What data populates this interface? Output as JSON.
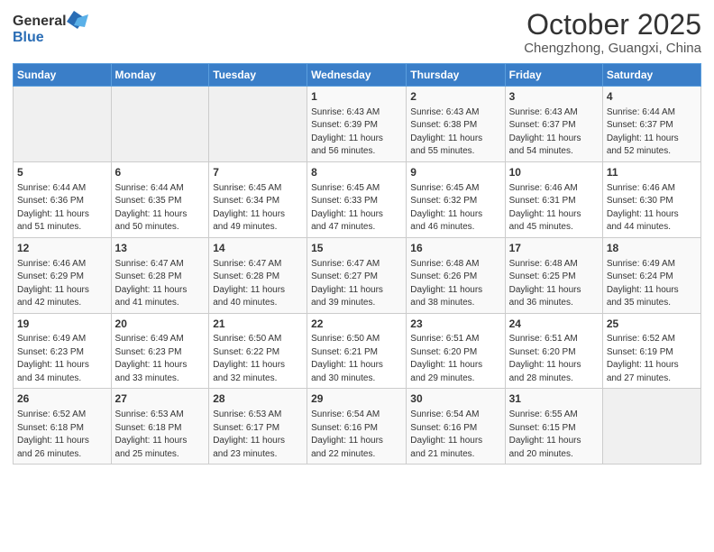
{
  "header": {
    "logo_general": "General",
    "logo_blue": "Blue",
    "month": "October 2025",
    "location": "Chengzhong, Guangxi, China"
  },
  "weekdays": [
    "Sunday",
    "Monday",
    "Tuesday",
    "Wednesday",
    "Thursday",
    "Friday",
    "Saturday"
  ],
  "weeks": [
    [
      {
        "day": "",
        "info": ""
      },
      {
        "day": "",
        "info": ""
      },
      {
        "day": "",
        "info": ""
      },
      {
        "day": "1",
        "info": "Sunrise: 6:43 AM\nSunset: 6:39 PM\nDaylight: 11 hours\nand 56 minutes."
      },
      {
        "day": "2",
        "info": "Sunrise: 6:43 AM\nSunset: 6:38 PM\nDaylight: 11 hours\nand 55 minutes."
      },
      {
        "day": "3",
        "info": "Sunrise: 6:43 AM\nSunset: 6:37 PM\nDaylight: 11 hours\nand 54 minutes."
      },
      {
        "day": "4",
        "info": "Sunrise: 6:44 AM\nSunset: 6:37 PM\nDaylight: 11 hours\nand 52 minutes."
      }
    ],
    [
      {
        "day": "5",
        "info": "Sunrise: 6:44 AM\nSunset: 6:36 PM\nDaylight: 11 hours\nand 51 minutes."
      },
      {
        "day": "6",
        "info": "Sunrise: 6:44 AM\nSunset: 6:35 PM\nDaylight: 11 hours\nand 50 minutes."
      },
      {
        "day": "7",
        "info": "Sunrise: 6:45 AM\nSunset: 6:34 PM\nDaylight: 11 hours\nand 49 minutes."
      },
      {
        "day": "8",
        "info": "Sunrise: 6:45 AM\nSunset: 6:33 PM\nDaylight: 11 hours\nand 47 minutes."
      },
      {
        "day": "9",
        "info": "Sunrise: 6:45 AM\nSunset: 6:32 PM\nDaylight: 11 hours\nand 46 minutes."
      },
      {
        "day": "10",
        "info": "Sunrise: 6:46 AM\nSunset: 6:31 PM\nDaylight: 11 hours\nand 45 minutes."
      },
      {
        "day": "11",
        "info": "Sunrise: 6:46 AM\nSunset: 6:30 PM\nDaylight: 11 hours\nand 44 minutes."
      }
    ],
    [
      {
        "day": "12",
        "info": "Sunrise: 6:46 AM\nSunset: 6:29 PM\nDaylight: 11 hours\nand 42 minutes."
      },
      {
        "day": "13",
        "info": "Sunrise: 6:47 AM\nSunset: 6:28 PM\nDaylight: 11 hours\nand 41 minutes."
      },
      {
        "day": "14",
        "info": "Sunrise: 6:47 AM\nSunset: 6:28 PM\nDaylight: 11 hours\nand 40 minutes."
      },
      {
        "day": "15",
        "info": "Sunrise: 6:47 AM\nSunset: 6:27 PM\nDaylight: 11 hours\nand 39 minutes."
      },
      {
        "day": "16",
        "info": "Sunrise: 6:48 AM\nSunset: 6:26 PM\nDaylight: 11 hours\nand 38 minutes."
      },
      {
        "day": "17",
        "info": "Sunrise: 6:48 AM\nSunset: 6:25 PM\nDaylight: 11 hours\nand 36 minutes."
      },
      {
        "day": "18",
        "info": "Sunrise: 6:49 AM\nSunset: 6:24 PM\nDaylight: 11 hours\nand 35 minutes."
      }
    ],
    [
      {
        "day": "19",
        "info": "Sunrise: 6:49 AM\nSunset: 6:23 PM\nDaylight: 11 hours\nand 34 minutes."
      },
      {
        "day": "20",
        "info": "Sunrise: 6:49 AM\nSunset: 6:23 PM\nDaylight: 11 hours\nand 33 minutes."
      },
      {
        "day": "21",
        "info": "Sunrise: 6:50 AM\nSunset: 6:22 PM\nDaylight: 11 hours\nand 32 minutes."
      },
      {
        "day": "22",
        "info": "Sunrise: 6:50 AM\nSunset: 6:21 PM\nDaylight: 11 hours\nand 30 minutes."
      },
      {
        "day": "23",
        "info": "Sunrise: 6:51 AM\nSunset: 6:20 PM\nDaylight: 11 hours\nand 29 minutes."
      },
      {
        "day": "24",
        "info": "Sunrise: 6:51 AM\nSunset: 6:20 PM\nDaylight: 11 hours\nand 28 minutes."
      },
      {
        "day": "25",
        "info": "Sunrise: 6:52 AM\nSunset: 6:19 PM\nDaylight: 11 hours\nand 27 minutes."
      }
    ],
    [
      {
        "day": "26",
        "info": "Sunrise: 6:52 AM\nSunset: 6:18 PM\nDaylight: 11 hours\nand 26 minutes."
      },
      {
        "day": "27",
        "info": "Sunrise: 6:53 AM\nSunset: 6:18 PM\nDaylight: 11 hours\nand 25 minutes."
      },
      {
        "day": "28",
        "info": "Sunrise: 6:53 AM\nSunset: 6:17 PM\nDaylight: 11 hours\nand 23 minutes."
      },
      {
        "day": "29",
        "info": "Sunrise: 6:54 AM\nSunset: 6:16 PM\nDaylight: 11 hours\nand 22 minutes."
      },
      {
        "day": "30",
        "info": "Sunrise: 6:54 AM\nSunset: 6:16 PM\nDaylight: 11 hours\nand 21 minutes."
      },
      {
        "day": "31",
        "info": "Sunrise: 6:55 AM\nSunset: 6:15 PM\nDaylight: 11 hours\nand 20 minutes."
      },
      {
        "day": "",
        "info": ""
      }
    ]
  ]
}
